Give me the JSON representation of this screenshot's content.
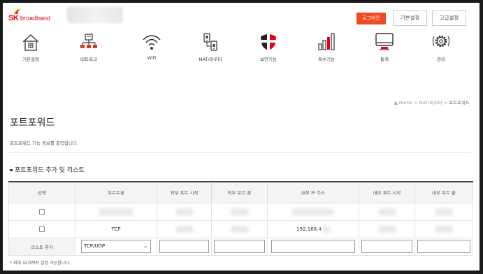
{
  "brand": {
    "name": "SK",
    "sub": "broadband",
    "color": "#e5001c"
  },
  "header": {
    "logout": "로그아웃",
    "basic_settings": "기본설정",
    "advanced_settings": "고급설정"
  },
  "nav": [
    {
      "label": "기본설정",
      "icon": "home-icon"
    },
    {
      "label": "네트워크",
      "icon": "network-icon"
    },
    {
      "label": "WiFi",
      "icon": "wifi-icon"
    },
    {
      "label": "NAT/라우터",
      "icon": "router-icon"
    },
    {
      "label": "보안기능",
      "icon": "shield-icon"
    },
    {
      "label": "특수기능",
      "icon": "bar-chart-icon"
    },
    {
      "label": "통계",
      "icon": "monitor-icon"
    },
    {
      "label": "관리",
      "icon": "gear-icon"
    }
  ],
  "breadcrumb": {
    "home": "Home",
    "sep": ">",
    "parent": "NAT/라우터",
    "current": "포트포워드"
  },
  "page": {
    "title": "포트포워드",
    "description": "포트포워드 기능 정보를 출력합니다.",
    "section_title": "포트포워드 추가 및 리스트"
  },
  "table": {
    "headers": [
      "선택",
      "프로토콜",
      "외부 포트 시작",
      "외부 포트 끝",
      "내부 IP 주소",
      "내부 포트 시작",
      "내부 포트 끝"
    ],
    "rows": [
      {
        "protocol": "",
        "ip": ""
      },
      {
        "protocol": "TCP",
        "ip": "192.168.4"
      }
    ],
    "add_row_label": "리스트 추가",
    "protocol_select": "TCP/UDP"
  },
  "footer_note": "* 최대 32개까지 설정 가능합니다.",
  "colors": {
    "accent": "#ee4a23",
    "nav_icon": "#333333",
    "shield_red": "#e5001c"
  }
}
